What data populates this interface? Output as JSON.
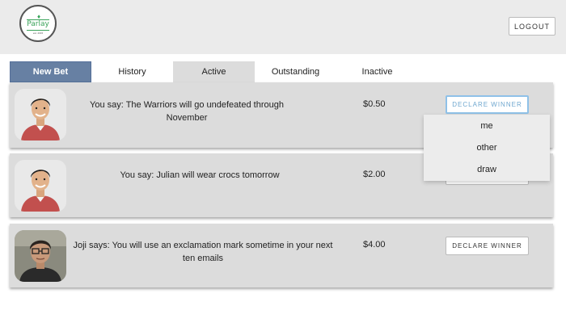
{
  "header": {
    "logo_text": "Parlay",
    "logo_tagline": "est. 2015",
    "logout_label": "LOGOUT"
  },
  "tabs": [
    {
      "label": "New Bet"
    },
    {
      "label": "History"
    },
    {
      "label": "Active"
    },
    {
      "label": "Outstanding"
    },
    {
      "label": "Inactive"
    }
  ],
  "bets": [
    {
      "text": "You say: The Warriors will go undefeated through November",
      "amount": "$0.50",
      "button": "DECLARE WINNER",
      "avatar": "smiling-man-avatar"
    },
    {
      "text": "You say: Julian will wear crocs tomorrow",
      "amount": "$2.00",
      "button": "DECLARE WINNER",
      "avatar": "smiling-man-avatar"
    },
    {
      "text": "Joji says: You will use an exclamation mark sometime in your next ten emails",
      "amount": "$4.00",
      "button": "DECLARE WINNER",
      "avatar": "man-with-glasses-avatar"
    }
  ],
  "dropdown": {
    "options": [
      "me",
      "other",
      "draw"
    ]
  },
  "colors": {
    "new_bet_tab": "#6780a3",
    "row_background": "#dcdcdc",
    "header_background": "#ebebeb",
    "logo_green": "#3aa35a",
    "focus_blue": "#8fc1e8"
  }
}
